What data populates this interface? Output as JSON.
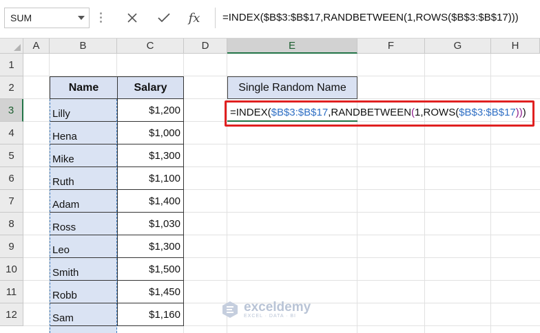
{
  "formula_bar": {
    "name_box": "SUM",
    "cancel_icon": "close-icon",
    "enter_icon": "check-icon",
    "fx_label": "fx",
    "formula": "=INDEX($B$3:$B$17,RANDBETWEEN(1,ROWS($B$3:$B$17)))"
  },
  "columns": [
    "A",
    "B",
    "C",
    "D",
    "E",
    "F",
    "G",
    "H"
  ],
  "selected_column": "E",
  "rows": [
    "1",
    "2",
    "3",
    "4",
    "5",
    "6",
    "7",
    "8",
    "9",
    "10",
    "11",
    "12"
  ],
  "selected_row": "3",
  "table": {
    "headers": {
      "name": "Name",
      "salary": "Salary"
    },
    "rows": [
      {
        "name": "Lilly",
        "salary": "$1,200"
      },
      {
        "name": "Hena",
        "salary": "$1,000"
      },
      {
        "name": "Mike",
        "salary": "$1,300"
      },
      {
        "name": "Ruth",
        "salary": "$1,100"
      },
      {
        "name": "Adam",
        "salary": "$1,400"
      },
      {
        "name": "Ross",
        "salary": "$1,030"
      },
      {
        "name": "Leo",
        "salary": "$1,300"
      },
      {
        "name": "Smith",
        "salary": "$1,500"
      },
      {
        "name": "Robb",
        "salary": "$1,450"
      },
      {
        "name": "Sam",
        "salary": "$1,160"
      }
    ]
  },
  "result": {
    "title": "Single Random Name",
    "formula_parts": {
      "p1": "=INDEX(",
      "ref1": "$B$3:$B$17",
      "p2": ",RANDBETWEEN",
      "p3": "(",
      "p4": "1,ROWS(",
      "ref2": "$B$3:$B$17",
      "p5": "))",
      "p6": ")"
    },
    "highlight_color": "#e02020"
  },
  "watermark": {
    "name": "exceldemy",
    "tagline": "EXCEL · DATA · BI"
  }
}
